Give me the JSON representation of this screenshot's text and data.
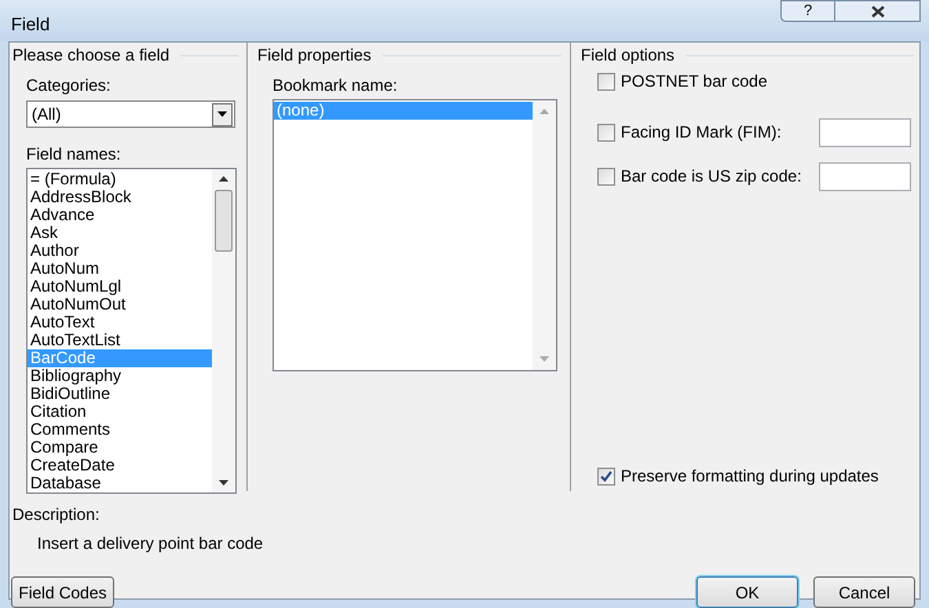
{
  "window": {
    "title": "Field",
    "help_button": "?"
  },
  "choose_panel": {
    "heading": "Please choose a field",
    "categories_label": "Categories:",
    "categories_value": "(All)",
    "field_names_label": "Field names:",
    "field_names": [
      {
        "label": "= (Formula)",
        "selected": false
      },
      {
        "label": "AddressBlock",
        "selected": false
      },
      {
        "label": "Advance",
        "selected": false
      },
      {
        "label": "Ask",
        "selected": false
      },
      {
        "label": "Author",
        "selected": false
      },
      {
        "label": "AutoNum",
        "selected": false
      },
      {
        "label": "AutoNumLgl",
        "selected": false
      },
      {
        "label": "AutoNumOut",
        "selected": false
      },
      {
        "label": "AutoText",
        "selected": false
      },
      {
        "label": "AutoTextList",
        "selected": false
      },
      {
        "label": "BarCode",
        "selected": true
      },
      {
        "label": "Bibliography",
        "selected": false
      },
      {
        "label": "BidiOutline",
        "selected": false
      },
      {
        "label": "Citation",
        "selected": false
      },
      {
        "label": "Comments",
        "selected": false
      },
      {
        "label": "Compare",
        "selected": false
      },
      {
        "label": "CreateDate",
        "selected": false
      },
      {
        "label": "Database",
        "selected": false
      }
    ]
  },
  "properties_panel": {
    "heading": "Field properties",
    "bookmark_label": "Bookmark name:",
    "bookmarks": [
      {
        "label": "(none)",
        "selected": true
      }
    ]
  },
  "options_panel": {
    "heading": "Field options",
    "options": [
      {
        "kind": "checkbox",
        "label": "POSTNET bar code",
        "checked": false
      },
      {
        "kind": "checkbox_field",
        "label": "Facing ID Mark (FIM):",
        "checked": false
      },
      {
        "kind": "checkbox_field",
        "label": "Bar code is US zip code:",
        "checked": false
      }
    ],
    "preserve": {
      "label": "Preserve formatting during updates",
      "checked": true
    }
  },
  "description": {
    "label": "Description:",
    "text": "Insert a delivery point bar code"
  },
  "buttons": [
    {
      "label": "Field Codes",
      "default": false
    },
    {
      "label": "OK",
      "default": true
    },
    {
      "label": "Cancel",
      "default": false
    }
  ]
}
